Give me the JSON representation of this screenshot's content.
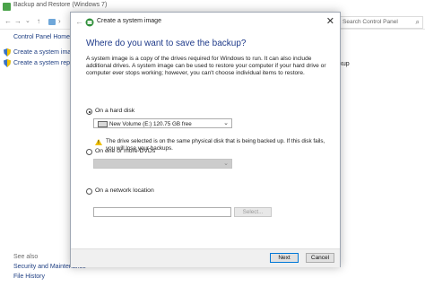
{
  "background_window": {
    "title": "Backup and Restore (Windows 7)",
    "breadcrumb_sep": "›",
    "search_placeholder": "Search Control Panel",
    "sidebar": {
      "home_link": "Control Panel Home",
      "items": [
        {
          "label": "Create a system image",
          "icon": "shield-icon"
        },
        {
          "label": "Create a system repair disc",
          "icon": "shield-icon"
        }
      ],
      "see_also_label": "See also",
      "see_also_items": [
        "Security and Maintenance",
        "File History"
      ]
    },
    "right_button_partial": "ackup"
  },
  "dialog": {
    "title": "Create a system image",
    "close_glyph": "✕",
    "back_glyph": "←",
    "heading": "Where do you want to save the backup?",
    "description": "A system image is a copy of the drives required for Windows to run. It can also include additional drives. A system image can be used to restore your computer if your hard drive or computer ever stops working; however, you can't choose individual items to restore.",
    "options": {
      "hard_disk": {
        "label": "On a hard disk",
        "selected": true,
        "selected_drive": "New Volume (E:)  120.75 GB free",
        "warning": "The drive selected is on the same physical disk that is being backed up. If this disk fails, you will lose your backups."
      },
      "dvds": {
        "label": "On one or more DVDs",
        "selected": false,
        "selected_drive": ""
      },
      "network": {
        "label": "On a network location",
        "selected": false,
        "location_value": "",
        "select_button": "Select..."
      }
    },
    "buttons": {
      "next": "Next",
      "cancel": "Cancel"
    }
  },
  "colors": {
    "heading": "#1e3a8a",
    "primary_border": "#0078d7",
    "warning": "#f0c000",
    "link": "#1f3f83"
  }
}
